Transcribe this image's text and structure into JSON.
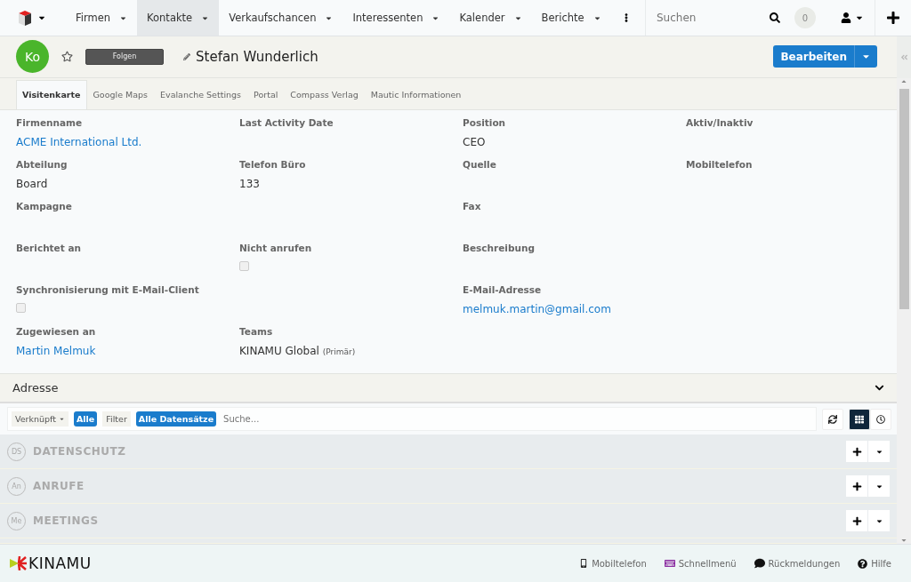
{
  "nav": {
    "items": [
      {
        "label": "Firmen",
        "selected": false
      },
      {
        "label": "Kontakte",
        "selected": true
      },
      {
        "label": "Verkaufschancen",
        "selected": false
      },
      {
        "label": "Interessenten",
        "selected": false
      },
      {
        "label": "Kalender",
        "selected": false
      },
      {
        "label": "Berichte",
        "selected": false
      }
    ],
    "search": {
      "placeholder": "Suchen"
    },
    "notifications": "0"
  },
  "record": {
    "avatar": "Ko",
    "follow": "Folgen",
    "name": "Stefan Wunderlich",
    "edit": "Bearbeiten"
  },
  "tabs": [
    {
      "label": "Visitenkarte",
      "selected": true
    },
    {
      "label": "Google Maps",
      "selected": false
    },
    {
      "label": "Evalanche Settings",
      "selected": false
    },
    {
      "label": "Portal",
      "selected": false
    },
    {
      "label": "Compass Verlag",
      "selected": false
    },
    {
      "label": "Mautic Informationen",
      "selected": false
    }
  ],
  "rows": [
    [
      {
        "kind": "link",
        "label": "Firmenname",
        "value": "ACME International Ltd."
      },
      {
        "kind": "text",
        "label": "Last Activity Date"
      },
      {
        "kind": "text",
        "label": "Position",
        "value": "CEO"
      },
      {
        "kind": "text",
        "label": "Aktiv/Inaktiv"
      }
    ],
    [
      {
        "kind": "text",
        "label": "Abteilung",
        "value": "Board"
      },
      {
        "kind": "text",
        "label": "Telefon Büro",
        "value": "133"
      },
      {
        "kind": "text",
        "label": "Quelle"
      },
      {
        "kind": "text",
        "label": "Mobiltelefon"
      }
    ],
    [
      {
        "kind": "text",
        "label": "Kampagne"
      },
      {
        "kind": "blank"
      },
      {
        "kind": "text",
        "label": "Fax"
      },
      {
        "kind": "blank"
      }
    ],
    [
      {
        "kind": "text",
        "label": "Berichtet an"
      },
      {
        "kind": "checkbox",
        "label": "Nicht anrufen",
        "checked": false
      },
      {
        "kind": "text",
        "label": "Beschreibung"
      },
      {
        "kind": "blank"
      }
    ],
    [
      {
        "kind": "checkbox",
        "label": "Synchronisierung mit E-Mail-Client",
        "checked": false
      },
      {
        "kind": "blank"
      },
      {
        "kind": "link",
        "label": "E-Mail-Adresse",
        "value": "melmuk.martin@gmail.com"
      },
      {
        "kind": "blank"
      }
    ],
    [
      {
        "kind": "link",
        "label": "Zugewiesen an",
        "value": "Martin Melmuk"
      },
      {
        "kind": "text",
        "label": "Teams",
        "value": "KINAMU Global",
        "note": "(Primär)"
      },
      {
        "kind": "blank"
      },
      {
        "kind": "blank"
      }
    ]
  ],
  "address_panel": {
    "title": "Adresse",
    "expanded": false
  },
  "filter": {
    "linked": "Verknüpft",
    "linked_value": "Alle",
    "filter": "Filter",
    "filter_value": "Alle Datensätze",
    "placeholder": "Suche...",
    "views": [
      {
        "kind": "grid",
        "selected": true
      },
      {
        "kind": "history",
        "selected": false
      }
    ]
  },
  "subpanels": [
    {
      "badge": "DS",
      "title": "DATENSCHUTZ"
    },
    {
      "badge": "An",
      "title": "ANRUFE"
    },
    {
      "badge": "Me",
      "title": "MEETINGS"
    }
  ],
  "footer": {
    "brand": "KINAMU",
    "links": [
      {
        "kind": "mobile",
        "label": "Mobiltelefon"
      },
      {
        "kind": "keyboard",
        "label": "Schnellmenü"
      },
      {
        "kind": "feedback",
        "label": "Rückmeldungen"
      },
      {
        "kind": "help",
        "label": "Hilfe"
      }
    ]
  }
}
